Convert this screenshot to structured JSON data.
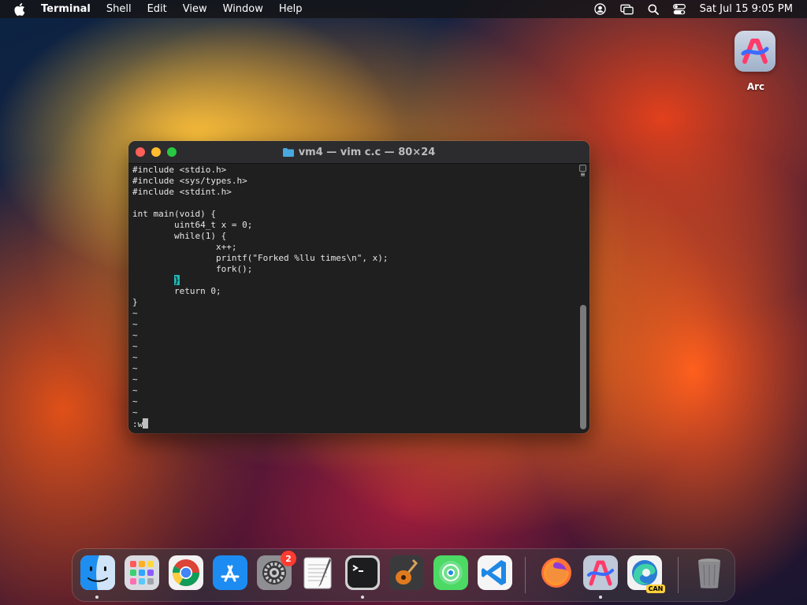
{
  "menubar": {
    "app_name": "Terminal",
    "items": [
      "Shell",
      "Edit",
      "View",
      "Window",
      "Help"
    ],
    "clock": "Sat Jul 15  9:05 PM"
  },
  "desktop": {
    "icons": [
      {
        "label": "Arc",
        "icon": "arc-icon"
      }
    ]
  },
  "terminal": {
    "title": "vm4 — vim c.c — 80×24",
    "lines": [
      "#include <stdio.h>",
      "#include <sys/types.h>",
      "#include <stdint.h>",
      "",
      "int main(void) {",
      "        uint64_t x = 0;",
      "        while(1) {",
      "                x++;",
      "                printf(\"Forked %llu times\\n\", x);",
      "                fork();",
      "        }",
      "        return 0;",
      "}",
      "~",
      "~",
      "~",
      "~",
      "~",
      "~",
      "~",
      "~",
      "~",
      "~"
    ],
    "command_line": ":w",
    "highlight_line_index": 10
  },
  "dock": {
    "items": [
      {
        "name": "Finder",
        "icon": "finder-icon"
      },
      {
        "name": "Launchpad",
        "icon": "launchpad-icon"
      },
      {
        "name": "Google Chrome",
        "icon": "chrome-icon"
      },
      {
        "name": "App Store",
        "icon": "app-store-icon"
      },
      {
        "name": "System Settings",
        "icon": "settings-icon",
        "badge": "2"
      },
      {
        "name": "TextEdit",
        "icon": "textedit-icon"
      },
      {
        "name": "Terminal",
        "icon": "terminal-icon"
      },
      {
        "name": "GarageBand",
        "icon": "guitar-icon"
      },
      {
        "name": "Find My",
        "icon": "find-my-icon"
      },
      {
        "name": "Visual Studio Code",
        "icon": "vscode-icon"
      },
      {
        "name": "Firefox",
        "icon": "firefox-icon"
      },
      {
        "name": "Arc",
        "icon": "arc-icon"
      },
      {
        "name": "Microsoft Edge Canary",
        "icon": "edge-icon",
        "badge": "CAN"
      },
      {
        "name": "Trash",
        "icon": "trash-icon"
      }
    ]
  }
}
